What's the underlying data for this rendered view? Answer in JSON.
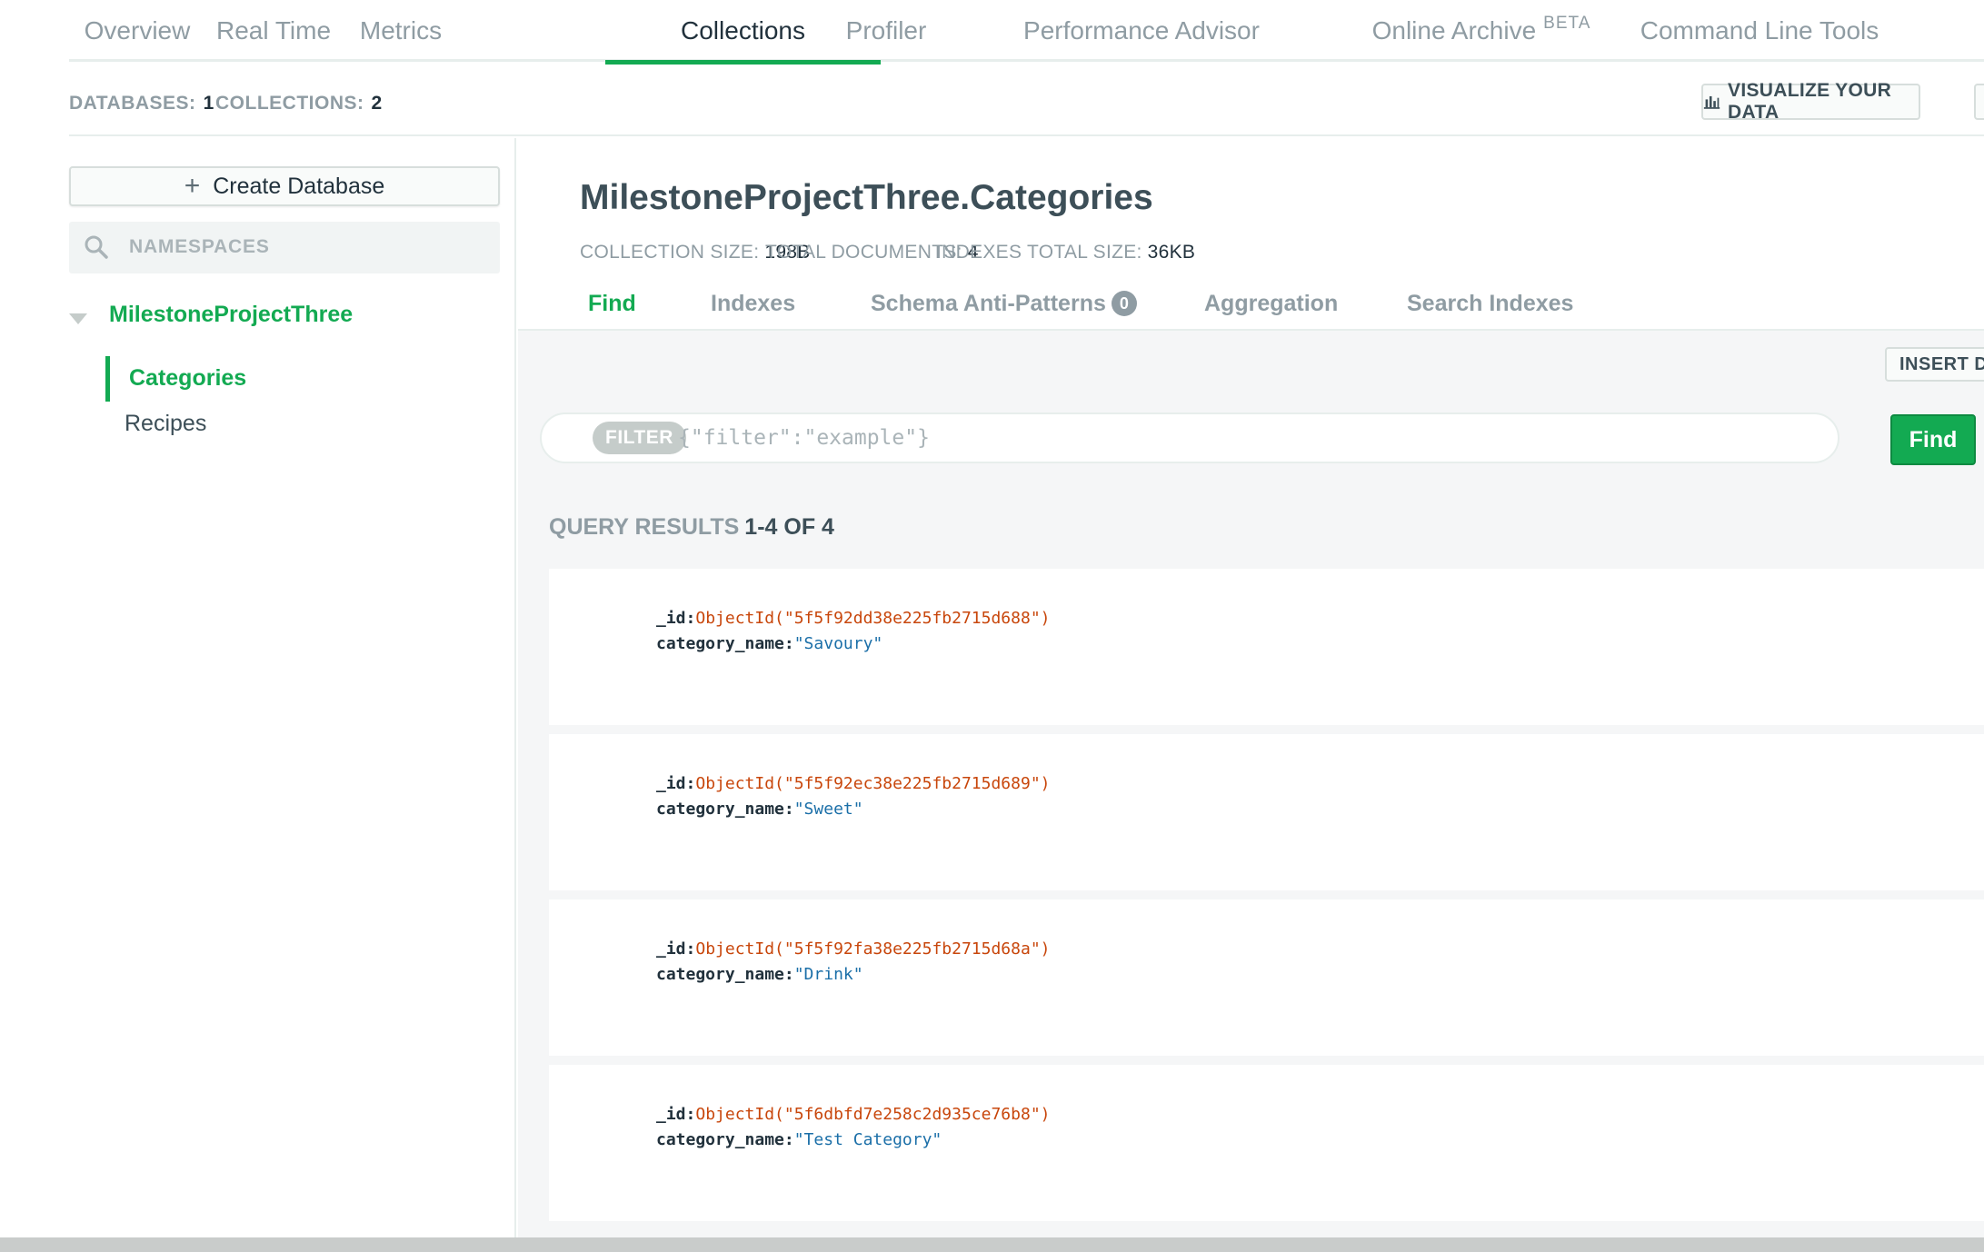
{
  "top_tabs": [
    {
      "label": "Overview"
    },
    {
      "label": "Real Time"
    },
    {
      "label": "Metrics"
    },
    {
      "label": "Collections"
    },
    {
      "label": "Profiler"
    },
    {
      "label": "Performance Advisor"
    },
    {
      "label": "Online Archive",
      "badge": "BETA"
    },
    {
      "label": "Command Line Tools"
    }
  ],
  "active_tab": "Collections",
  "stats": {
    "databases_label": "DATABASES:",
    "databases_value": "1",
    "collections_label": "COLLECTIONS:",
    "collections_value": "2",
    "visualize_label": "VISUALIZE YOUR DATA"
  },
  "sidebar": {
    "create_db_label": "Create Database",
    "search_placeholder": "NAMESPACES",
    "database": "MilestoneProjectThree",
    "collections": [
      {
        "label": "Categories",
        "active": true
      },
      {
        "label": "Recipes",
        "active": false
      }
    ]
  },
  "collection": {
    "title": "MilestoneProjectThree.Categories",
    "size_label": "COLLECTION SIZE:",
    "size_value": "198B",
    "docs_label": "TOTAL DOCUMENTS:",
    "docs_value": "4",
    "indexes_label": "INDEXES TOTAL SIZE:",
    "indexes_value": "36KB",
    "subtabs": [
      {
        "label": "Find",
        "active": true
      },
      {
        "label": "Indexes"
      },
      {
        "label": "Schema Anti-Patterns",
        "badge": "0"
      },
      {
        "label": "Aggregation"
      },
      {
        "label": "Search Indexes"
      }
    ]
  },
  "query": {
    "insert_label": "INSERT DOCUMENT",
    "filter_pill": "FILTER",
    "filter_placeholder": "{\"filter\":\"example\"}",
    "find_label": "Find",
    "results_label": "QUERY RESULTS",
    "results_value": "1-4 OF 4"
  },
  "documents": [
    {
      "id_key": "_id:",
      "id_value": "ObjectId(\"5f5f92dd38e225fb2715d688\")",
      "name_key": "category_name:",
      "name_value": "\"Savoury\""
    },
    {
      "id_key": "_id:",
      "id_value": "ObjectId(\"5f5f92ec38e225fb2715d689\")",
      "name_key": "category_name:",
      "name_value": "\"Sweet\""
    },
    {
      "id_key": "_id:",
      "id_value": "ObjectId(\"5f5f92fa38e225fb2715d68a\")",
      "name_key": "category_name:",
      "name_value": "\"Drink\""
    },
    {
      "id_key": "_id:",
      "id_value": "ObjectId(\"5f6dbfd7e258c2d935ce76b8\")",
      "name_key": "category_name:",
      "name_value": "\"Test Category\""
    }
  ],
  "colors": {
    "accent": "#13aa52",
    "oid": "#c8460b",
    "string": "#1b6fa8"
  }
}
